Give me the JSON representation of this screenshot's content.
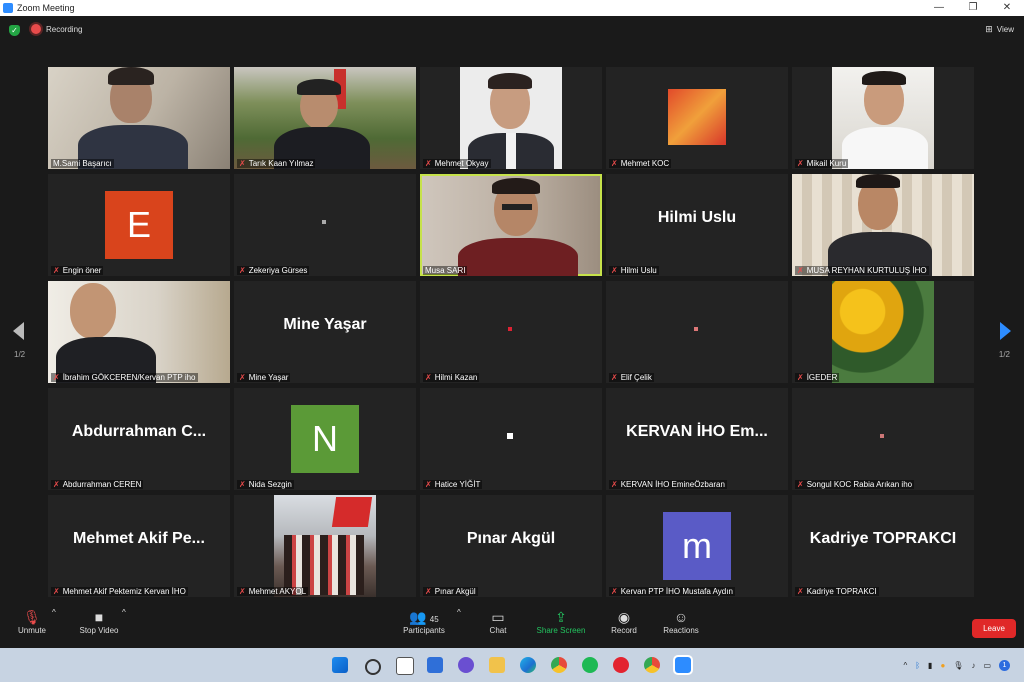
{
  "window": {
    "title": "Zoom Meeting",
    "min": "—",
    "max": "❐",
    "close": "✕"
  },
  "topbar": {
    "recording": "Recording",
    "view": "View"
  },
  "nav": {
    "page_left": "1/2",
    "page_right": "1/2"
  },
  "participants": [
    {
      "name": "M.Sami Başarıcı",
      "kind": "video",
      "muted": false
    },
    {
      "name": "Tarık Kaan Yılmaz",
      "kind": "video",
      "muted": true
    },
    {
      "name": "Mehmet Okyay",
      "kind": "video",
      "muted": true
    },
    {
      "name": "Mehmet KOC",
      "kind": "video",
      "muted": true
    },
    {
      "name": "Mikail Kuru",
      "kind": "video",
      "muted": true
    },
    {
      "name": "Engin öner",
      "kind": "avatar",
      "letter": "E",
      "color": "#d9441c",
      "muted": true
    },
    {
      "name": "Zekeriya Gürses",
      "kind": "dot",
      "muted": true
    },
    {
      "name": "Musa SARI",
      "kind": "video",
      "muted": false,
      "active": true
    },
    {
      "name": "Hilmi Uslu",
      "kind": "text",
      "display": "Hilmi Uslu",
      "muted": true
    },
    {
      "name": "MUSA REYHAN KURTULUŞ İHO",
      "kind": "video",
      "muted": true
    },
    {
      "name": "İbrahim GÖKCEREN/Kervan PTP iho",
      "kind": "video",
      "muted": true
    },
    {
      "name": "Mine Yaşar",
      "kind": "text",
      "display": "Mine Yaşar",
      "muted": true
    },
    {
      "name": "Hilmi Kazan",
      "kind": "dot",
      "muted": true
    },
    {
      "name": "Elif Çelik",
      "kind": "dot",
      "muted": true
    },
    {
      "name": "İGEDER",
      "kind": "video",
      "muted": true
    },
    {
      "name": "Abdurrahman CEREN",
      "kind": "text",
      "display": "Abdurrahman C...",
      "muted": true
    },
    {
      "name": "Nida Sezgin",
      "kind": "avatar",
      "letter": "N",
      "color": "#5b9a37",
      "muted": true
    },
    {
      "name": "Hatice YİĞİT",
      "kind": "dot",
      "muted": true
    },
    {
      "name": "KERVAN İHO EmineÖzbaran",
      "kind": "text",
      "display": "KERVAN İHO Em...",
      "muted": true
    },
    {
      "name": "Songul KOC Rabia Arıkan iho",
      "kind": "dot",
      "muted": true
    },
    {
      "name": "Mehmet Akif Pektemiz Kervan İHO",
      "kind": "text",
      "display": "Mehmet Akif Pe...",
      "muted": true
    },
    {
      "name": "Mehmet AKYOL",
      "kind": "video",
      "muted": true
    },
    {
      "name": "Pınar Akgül",
      "kind": "text",
      "display": "Pınar Akgül",
      "muted": true
    },
    {
      "name": "Kervan PTP İHO Mustafa Aydın",
      "kind": "avatar",
      "letter": "m",
      "color": "#5a5bc6",
      "muted": true
    },
    {
      "name": "Kadriye TOPRAKCI",
      "kind": "text",
      "display": "Kadriye TOPRAKCI",
      "muted": true
    }
  ],
  "toolbar": {
    "unmute": "Unmute",
    "stop_video": "Stop Video",
    "participants": "Participants",
    "participants_count": "45",
    "chat": "Chat",
    "share_screen": "Share Screen",
    "record": "Record",
    "reactions": "Reactions",
    "leave": "Leave"
  },
  "colors": {
    "accent": "#2d8cff",
    "share_green": "#23c35f",
    "leave_red": "#e02828",
    "active_border": "#c6e24a"
  },
  "taskbar": {
    "notif_count": "1"
  }
}
